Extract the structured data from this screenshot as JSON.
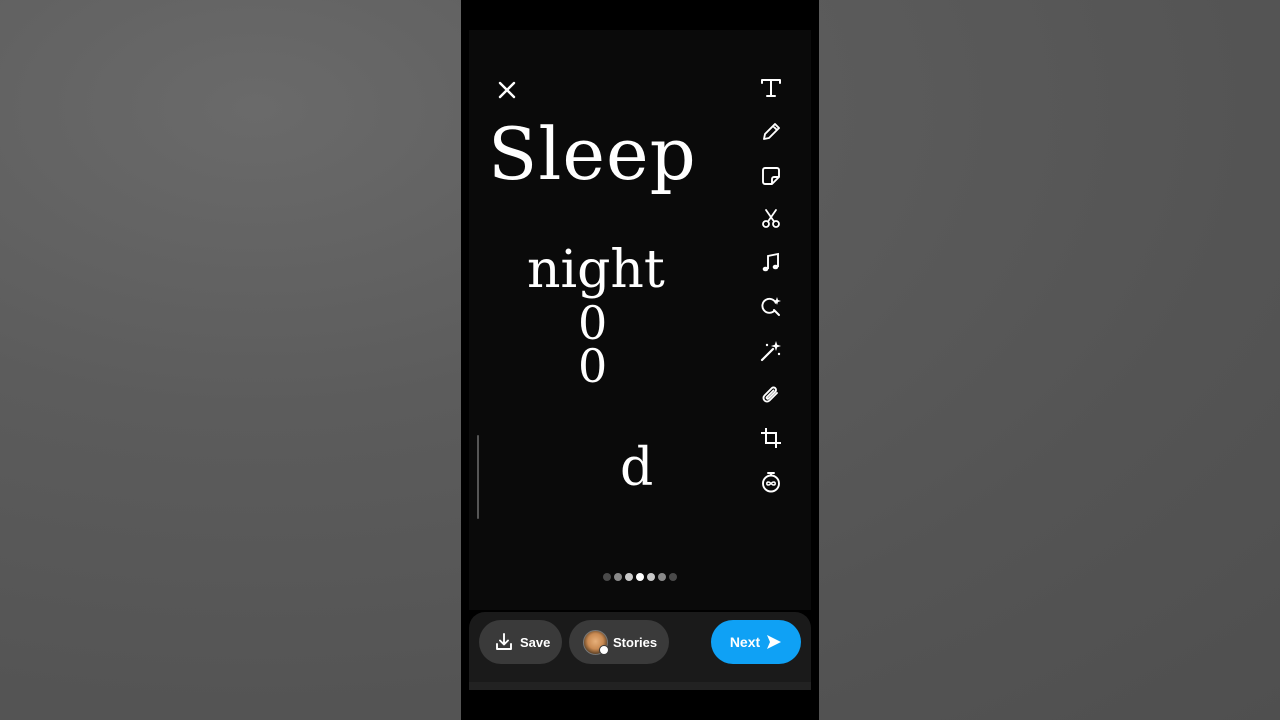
{
  "canvas": {
    "words": {
      "sleep": "Sleep",
      "night": "night",
      "o1": "0",
      "o2": "0",
      "d": "d"
    },
    "page_indicator": {
      "count": 7,
      "active_index": 3
    }
  },
  "toolbar": {
    "tools": [
      "text-icon",
      "pencil-icon",
      "sticker-icon",
      "scissors-icon",
      "music-icon",
      "lens-search-icon",
      "magic-wand-icon",
      "paperclip-icon",
      "crop-icon",
      "timer-icon"
    ]
  },
  "bottom_bar": {
    "save_label": "Save",
    "stories_label": "Stories",
    "next_label": "Next"
  },
  "colors": {
    "accent": "#0fa1f5",
    "canvas_bg": "#0a0a0a",
    "pill_bg": "#3a3a3a"
  }
}
